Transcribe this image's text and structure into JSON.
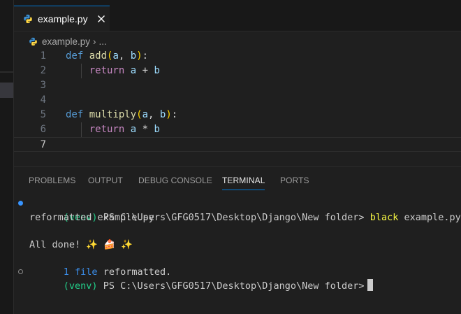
{
  "tab": {
    "label": "example.py",
    "close_glyph": "✕"
  },
  "breadcrumb": {
    "file": "example.py",
    "separator": "›",
    "more": "..."
  },
  "editor": {
    "lines": [
      {
        "num": "1",
        "tokens": [
          [
            "kw",
            "def"
          ],
          [
            "pun",
            " "
          ],
          [
            "fn",
            "add"
          ],
          [
            "par",
            "("
          ],
          [
            "var",
            "a"
          ],
          [
            "pun",
            ", "
          ],
          [
            "var",
            "b"
          ],
          [
            "par",
            ")"
          ],
          [
            "pun",
            ":"
          ]
        ]
      },
      {
        "num": "2",
        "tokens": [
          [
            "pun",
            "    "
          ],
          [
            "kw2",
            "return"
          ],
          [
            "pun",
            " "
          ],
          [
            "var",
            "a"
          ],
          [
            "pun",
            " + "
          ],
          [
            "var",
            "b"
          ]
        ]
      },
      {
        "num": "3",
        "tokens": []
      },
      {
        "num": "4",
        "tokens": []
      },
      {
        "num": "5",
        "tokens": [
          [
            "kw",
            "def"
          ],
          [
            "pun",
            " "
          ],
          [
            "fn",
            "multiply"
          ],
          [
            "par",
            "("
          ],
          [
            "var",
            "a"
          ],
          [
            "pun",
            ", "
          ],
          [
            "var",
            "b"
          ],
          [
            "par",
            ")"
          ],
          [
            "pun",
            ":"
          ]
        ]
      },
      {
        "num": "6",
        "tokens": [
          [
            "pun",
            "    "
          ],
          [
            "kw2",
            "return"
          ],
          [
            "pun",
            " "
          ],
          [
            "var",
            "a"
          ],
          [
            "pun",
            " * "
          ],
          [
            "var",
            "b"
          ]
        ]
      },
      {
        "num": "7",
        "tokens": []
      }
    ],
    "current_line": "7"
  },
  "panel": {
    "tabs": [
      {
        "label": "PROBLEMS",
        "active": false
      },
      {
        "label": "OUTPUT",
        "active": false
      },
      {
        "label": "DEBUG CONSOLE",
        "active": false
      },
      {
        "label": "TERMINAL",
        "active": true
      },
      {
        "label": "PORTS",
        "active": false
      }
    ]
  },
  "terminal": {
    "prompt_env": "(venv)",
    "prompt_path": " PS C:\\Users\\GFG0517\\Desktop\\Django\\New folder> ",
    "command_name": "black",
    "command_args": " example.py",
    "output_1": "reformatted example.py",
    "output_blank": "",
    "all_done": "All done! ✨ 🍰 ✨",
    "summary_count": "1 file",
    "summary_rest": " reformatted.",
    "prompt2_env": "(venv)",
    "prompt2_path": " PS C:\\Users\\GFG0517\\Desktop\\Django\\New folder>"
  },
  "colors": {
    "accent": "#0078d4",
    "background": "#1f1f1f",
    "terminal_green": "#23d18b",
    "terminal_yellow": "#f5f543",
    "terminal_blue": "#3b8eea"
  },
  "icons": [
    "python-file-icon",
    "close-icon",
    "terminal-success-dot-icon",
    "terminal-idle-dot-icon"
  ]
}
